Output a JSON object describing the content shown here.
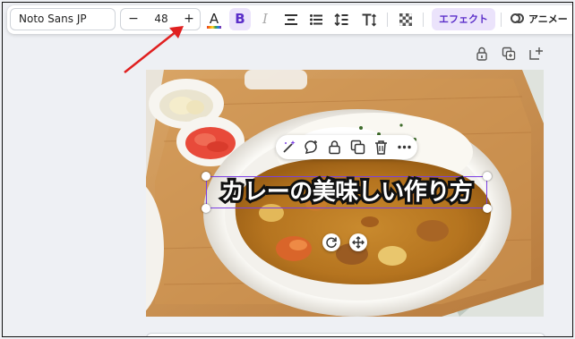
{
  "toolbar": {
    "font_family": "Noto Sans JP",
    "font_size": "48",
    "minus_label": "−",
    "plus_label": "+",
    "color_label": "A",
    "bold_label": "B",
    "italic_label": "I",
    "effect_label": "エフェクト",
    "animate_label": "アニメー"
  },
  "canvas": {
    "headline": "カレーの美味しい作り方"
  },
  "icons": [
    "text-color-icon",
    "bold-icon",
    "italic-icon",
    "align-center-icon",
    "bullet-list-icon",
    "line-spacing-icon",
    "text-resize-icon",
    "transparency-icon",
    "lock-icon",
    "duplicate-icon",
    "add-page-icon",
    "magic-edit-icon",
    "comment-icon",
    "delete-icon",
    "more-icon",
    "rotate-icon",
    "move-icon",
    "annotation-arrow"
  ],
  "colors": {
    "accent_purple": "#7b3fe4",
    "accent_bg": "#ebe3fb",
    "annotation_arrow": "#e02020"
  }
}
